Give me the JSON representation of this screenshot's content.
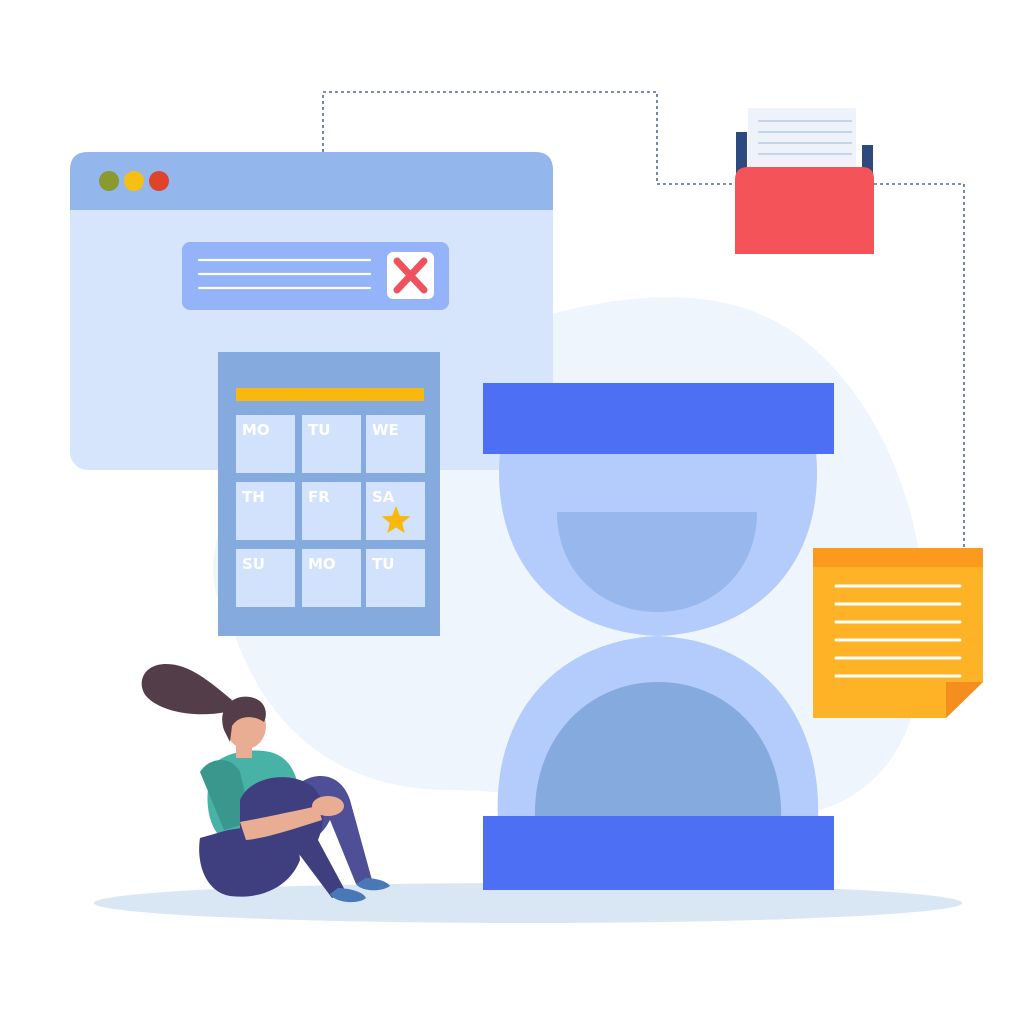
{
  "colors": {
    "background": "#ffffff",
    "blob": "#eef5fd",
    "ground_shadow": "#d9e6f4",
    "connector": "#4f6b95",
    "browser_header": "#93b6ec",
    "browser_body": "#d6e5fc",
    "dot_olive": "#8a9a2e",
    "dot_yellow": "#f5c013",
    "dot_red": "#e0432b",
    "error_bar": "#95b3f8",
    "error_line": "#ffffff",
    "error_x": "#f0525d",
    "calendar_frame": "#84aade",
    "calendar_strip": "#f9b80e",
    "calendar_cell": "#d2e2fd",
    "calendar_text": "#ffffff",
    "star": "#f9b80e",
    "hourglass_cap": "#4d6ff3",
    "hourglass_bulb": "#b3ccfb",
    "hourglass_sand_top": "#97b7ed",
    "hourglass_sand_bottom": "#84aade",
    "file_box": "#f5535a",
    "file_side": "#2c4a7e",
    "file_paper": "#eef3fb",
    "note_body": "#fdb325",
    "note_header": "#fb9a1d",
    "note_fold": "#f58e1e",
    "woman_hair": "#523d48",
    "woman_skin": "#e9ad93",
    "woman_shirt": "#48b2a6",
    "woman_shirt_dark": "#3a978d",
    "woman_pants": "#3f3f80",
    "woman_pants_light": "#4f4f98",
    "woman_shoe": "#4a78b6"
  },
  "icons": {
    "error": "close-x-icon",
    "favorite_day": "star-icon",
    "file_tray": "file-tray-icon",
    "note": "sticky-note-icon",
    "timer": "hourglass-icon"
  },
  "calendar": {
    "days": [
      [
        "MO",
        "TU",
        "WE"
      ],
      [
        "TH",
        "FR",
        "SA"
      ],
      [
        "SU",
        "MO",
        "TU"
      ]
    ],
    "starred_day": "SA"
  }
}
